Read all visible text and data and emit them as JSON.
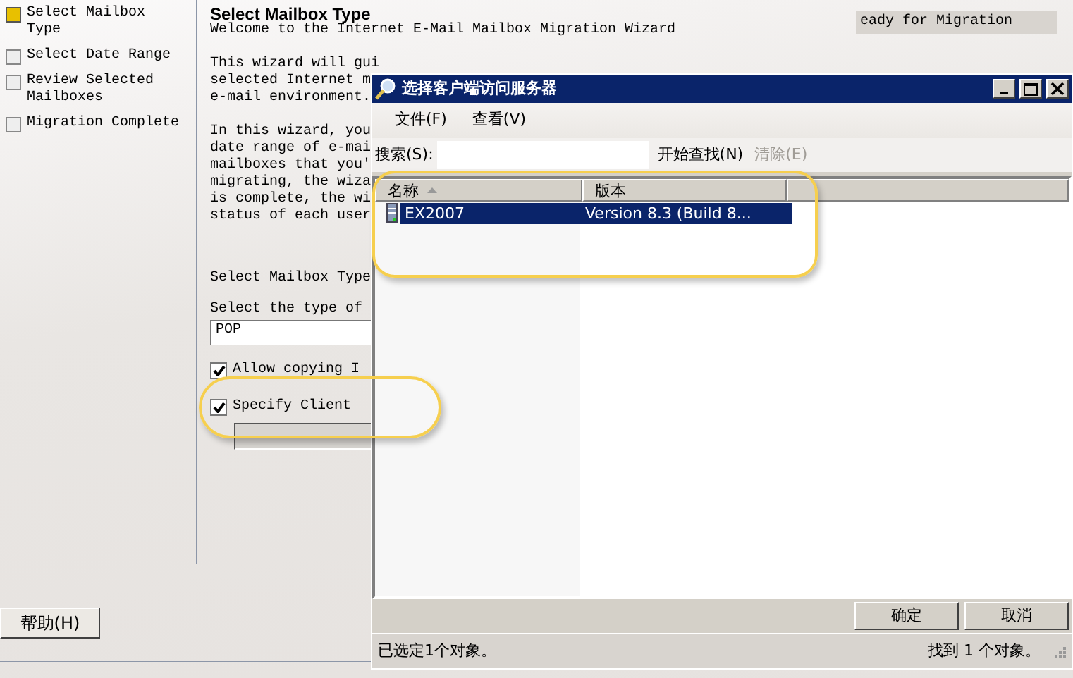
{
  "wizard": {
    "steps": [
      {
        "label": "Select Mailbox Type",
        "selected": true
      },
      {
        "label": "Select Date Range",
        "selected": false
      },
      {
        "label": "Review Selected Mailboxes",
        "selected": false
      },
      {
        "label": "Migration Complete",
        "selected": false
      }
    ],
    "heading": "Select Mailbox Type",
    "intro": "Welcome to the Internet E-Mail Mailbox Migration Wizard",
    "paragraph_1": [
      "This wizard will gui",
      "selected Internet m",
      "e-mail environment."
    ],
    "paragraph_2": [
      "In this wizard, you",
      "date range of e-mai",
      "mailboxes that you'",
      "migrating, the wiza",
      "is complete, the wi",
      "status of each user"
    ],
    "section_title": "Select Mailbox Type",
    "type_label": "Select the type of",
    "type_value": "POP",
    "options": [
      {
        "label": "Allow copying I",
        "checked": true
      },
      {
        "label": "Specify Client",
        "checked": true
      }
    ],
    "help_button": "帮助(H)"
  },
  "status_panel": {
    "rows": [
      "eady for Migration"
    ]
  },
  "dialog": {
    "title": "选择客户端访问服务器",
    "menu": [
      "文件(F)",
      "查看(V)"
    ],
    "search": {
      "label": "搜索(S):",
      "find_button": "开始查找(N)",
      "clear_button": {
        "label": "清除(E)",
        "disabled": true
      }
    },
    "list": {
      "columns": [
        {
          "label": "名称",
          "sorted": true
        },
        {
          "label": "版本",
          "sorted": false
        }
      ],
      "rows": [
        {
          "cells": [
            "EX2007",
            "Version 8.3 (Build 8..."
          ],
          "selected": true
        }
      ]
    },
    "buttons": [
      "确定",
      "取消"
    ],
    "status_left": "已选定1个对象。",
    "status_right": "找到 1 个对象。"
  }
}
